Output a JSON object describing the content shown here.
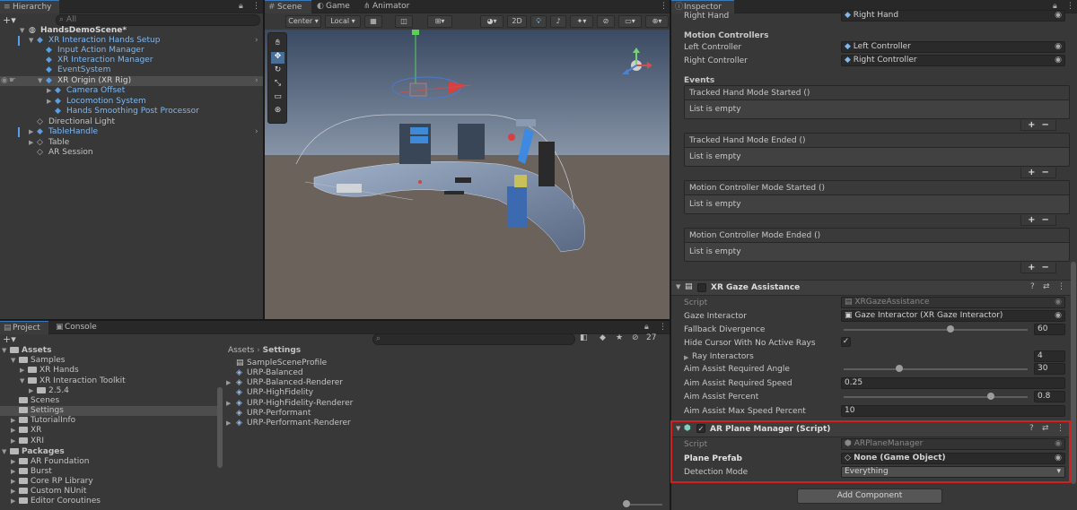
{
  "hierarchy": {
    "tab": "Hierarchy",
    "search_placeholder": "All",
    "add": "+▾",
    "scene": "HandsDemoScene*",
    "items": [
      {
        "label": "XR Interaction Hands Setup"
      },
      {
        "label": "Input Action Manager"
      },
      {
        "label": "XR Interaction Manager"
      },
      {
        "label": "EventSystem"
      },
      {
        "label": "XR Origin (XR Rig)"
      },
      {
        "label": "Camera Offset"
      },
      {
        "label": "Locomotion System"
      },
      {
        "label": "Hands Smoothing Post Processor"
      },
      {
        "label": "Directional Light"
      },
      {
        "label": "TableHandle"
      },
      {
        "label": "Table"
      },
      {
        "label": "AR Session"
      }
    ]
  },
  "scene_view": {
    "tabs": [
      "Scene",
      "Game",
      "Animator"
    ],
    "toolbar": {
      "pivot": "Center",
      "space": "Local",
      "mode_2d": "2D"
    }
  },
  "project": {
    "tabs": [
      "Project",
      "Console"
    ],
    "hidden_count": "27",
    "tree": [
      {
        "label": "Assets"
      },
      {
        "label": "Samples"
      },
      {
        "label": "XR Hands"
      },
      {
        "label": "XR Interaction Toolkit"
      },
      {
        "label": "2.5.4"
      },
      {
        "label": "Scenes"
      },
      {
        "label": "Settings"
      },
      {
        "label": "TutorialInfo"
      },
      {
        "label": "XR"
      },
      {
        "label": "XRI"
      },
      {
        "label": "Packages"
      },
      {
        "label": "AR Foundation"
      },
      {
        "label": "Burst"
      },
      {
        "label": "Core RP Library"
      },
      {
        "label": "Custom NUnit"
      },
      {
        "label": "Editor Coroutines"
      }
    ],
    "breadcrumb": [
      "Assets",
      "Settings"
    ],
    "files": [
      {
        "label": "SampleSceneProfile"
      },
      {
        "label": "URP-Balanced"
      },
      {
        "label": "URP-Balanced-Renderer"
      },
      {
        "label": "URP-HighFidelity"
      },
      {
        "label": "URP-HighFidelity-Renderer"
      },
      {
        "label": "URP-Performant"
      },
      {
        "label": "URP-Performant-Renderer"
      }
    ]
  },
  "inspector": {
    "tab": "Inspector",
    "right_hand": {
      "label": "Right Hand",
      "value": "Right Hand"
    },
    "motion_controllers": {
      "title": "Motion Controllers",
      "left_label": "Left Controller",
      "left_value": "Left Controller",
      "right_label": "Right Controller",
      "right_value": "Right Controller"
    },
    "events": {
      "title": "Events",
      "items": [
        {
          "name": "Tracked Hand Mode Started ()",
          "body": "List is empty"
        },
        {
          "name": "Tracked Hand Mode Ended ()",
          "body": "List is empty"
        },
        {
          "name": "Motion Controller Mode Started ()",
          "body": "List is empty"
        },
        {
          "name": "Motion Controller Mode Ended ()",
          "body": "List is empty"
        }
      ],
      "plus": "+",
      "minus": "−"
    },
    "gaze": {
      "title": "XR Gaze Assistance",
      "script_label": "Script",
      "script_value": "XRGazeAssistance",
      "interactor_label": "Gaze Interactor",
      "interactor_value": "Gaze Interactor (XR Gaze Interactor)",
      "fallback_label": "Fallback Divergence",
      "fallback_value": "60",
      "fallback_fill": 0.58,
      "hide_cursor_label": "Hide Cursor With No Active Rays",
      "hide_cursor_checked": "✓",
      "ray_label": "Ray Interactors",
      "ray_value": "4",
      "angle_label": "Aim Assist Required Angle",
      "angle_value": "30",
      "angle_fill": 0.3,
      "speed_label": "Aim Assist Required Speed",
      "speed_value": "0.25",
      "percent_label": "Aim Assist Percent",
      "percent_value": "0.8",
      "percent_fill": 0.8,
      "max_speed_label": "Aim Assist Max Speed Percent",
      "max_speed_value": "10"
    },
    "ar_plane": {
      "title": "AR Plane Manager (Script)",
      "script_label": "Script",
      "script_value": "ARPlaneManager",
      "prefab_label": "Plane Prefab",
      "prefab_value": "None (Game Object)",
      "detection_label": "Detection Mode",
      "detection_value": "Everything"
    },
    "add_component": "Add Component",
    "highlight_color": "#d0201f"
  }
}
